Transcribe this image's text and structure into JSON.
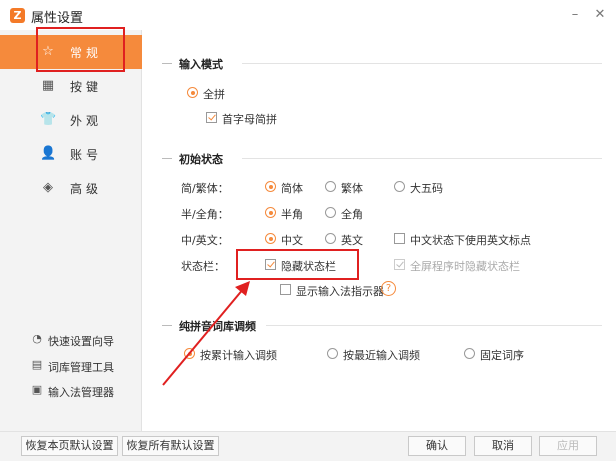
{
  "window": {
    "title": "属性设置",
    "logo_glyph": "Z",
    "minimize_glyph": "–",
    "close_glyph": "✕"
  },
  "sidebar": {
    "items": [
      {
        "label": "常规",
        "icon": "star-icon",
        "glyph": "☆",
        "active": true
      },
      {
        "label": "按键",
        "icon": "keyboard-icon",
        "glyph": "▦",
        "active": false
      },
      {
        "label": "外观",
        "icon": "tshirt-icon",
        "glyph": "👕",
        "active": false
      },
      {
        "label": "账号",
        "icon": "user-icon",
        "glyph": "👤",
        "active": false
      },
      {
        "label": "高级",
        "icon": "layers-icon",
        "glyph": "◈",
        "active": false
      }
    ],
    "tools": [
      {
        "label": "快速设置向导",
        "icon": "wizard-icon",
        "glyph": "◔"
      },
      {
        "label": "词库管理工具",
        "icon": "dictionary-icon",
        "glyph": "▤"
      },
      {
        "label": "输入法管理器",
        "icon": "manager-icon",
        "glyph": "▣"
      }
    ]
  },
  "sections": {
    "input_mode": {
      "title": "输入模式",
      "quanpin": "全拼",
      "initial_abbrev": "首字母简拼"
    },
    "initial_state": {
      "title": "初始状态",
      "rows": [
        {
          "label": "简/繁体：",
          "options": [
            "简体",
            "繁体",
            "大五码"
          ],
          "selected": "简体"
        },
        {
          "label": "半/全角：",
          "options": [
            "半角",
            "全角"
          ],
          "selected": "半角"
        },
        {
          "label": "中/英文：",
          "options": [
            "中文",
            "英文"
          ],
          "selected": "中文",
          "extra_check": "中文状态下使用英文标点"
        }
      ],
      "status_bar_label": "状态栏：",
      "hide_status_bar": "隐藏状态栏",
      "hide_on_fullscreen": "全屏程序时隐藏状态栏",
      "show_indicator": "显示输入法指示器",
      "help_glyph": "?"
    },
    "pinyin_freq": {
      "title": "纯拼音词库调频",
      "options": [
        "按累计输入调频",
        "按最近输入调频",
        "固定词序"
      ],
      "selected": "按累计输入调频"
    }
  },
  "footer": {
    "restore_page": "恢复本页默认设置",
    "restore_all": "恢复所有默认设置",
    "ok": "确认",
    "cancel": "取消",
    "apply": "应用"
  },
  "colors": {
    "accent": "#f58a3c",
    "highlight": "#e02020"
  }
}
